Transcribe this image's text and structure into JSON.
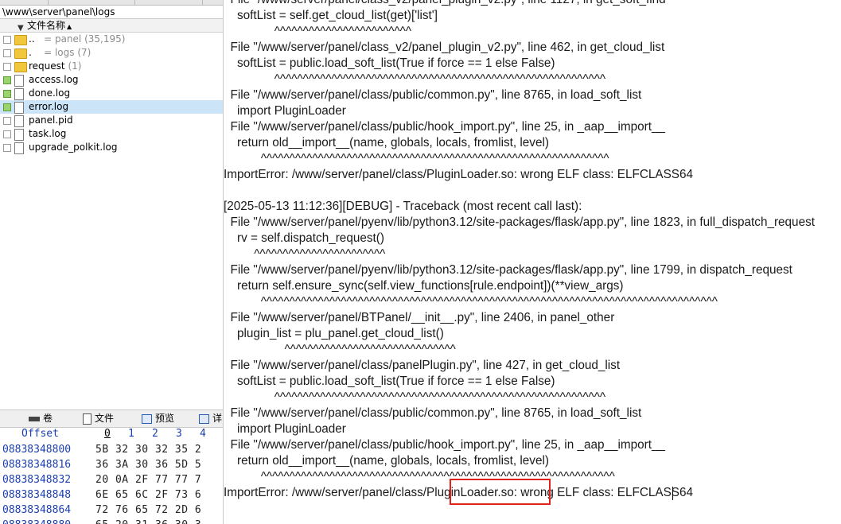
{
  "explorer": {
    "path": "\\www\\server\\panel\\logs",
    "column_header": "文件名称",
    "items": [
      {
        "name": "..",
        "suffix": "=   panel",
        "count": "(35,195)",
        "type": "folder"
      },
      {
        "name": ".",
        "suffix": "=   logs",
        "count": "(7)",
        "type": "folder"
      },
      {
        "name": "request",
        "count": "(1)",
        "type": "folder"
      },
      {
        "name": "access.log",
        "type": "file"
      },
      {
        "name": "done.log",
        "type": "file"
      },
      {
        "name": "error.log",
        "type": "file",
        "selected": true
      },
      {
        "name": "panel.pid",
        "type": "file"
      },
      {
        "name": "task.log",
        "type": "file"
      },
      {
        "name": "upgrade_polkit.log",
        "type": "file"
      }
    ]
  },
  "hex_tabs": [
    {
      "label": "卷",
      "icon": "volume-icon"
    },
    {
      "label": "文件",
      "icon": "file-icon"
    },
    {
      "label": "预览",
      "icon": "preview-icon"
    },
    {
      "label": "详",
      "icon": "details-icon"
    }
  ],
  "hex": {
    "offset_label": "Offset",
    "columns": [
      "0",
      "1",
      "2",
      "3",
      "4"
    ],
    "rows": [
      {
        "offset": "08838348800",
        "bytes": "5B 32 30 32 35 2"
      },
      {
        "offset": "08838348816",
        "bytes": "36 3A 30 36 5D 5"
      },
      {
        "offset": "08838348832",
        "bytes": "20 0A 2F 77 77 7"
      },
      {
        "offset": "08838348848",
        "bytes": "6E 65 6C 2F 73 6"
      },
      {
        "offset": "08838348864",
        "bytes": "72 76 65 72 2D 6"
      },
      {
        "offset": "08838348880",
        "bytes": "65 20 31 36 30 3"
      }
    ]
  },
  "log": {
    "lines": [
      "  File \"/www/server/panel/class_v2/panel_plugin_v2.py\", line 1127, in get_soft_find",
      "    softList = self.get_cloud_list(get)['list']",
      "               ^^^^^^^^^^^^^^^^^^^^^^^^",
      "  File \"/www/server/panel/class_v2/panel_plugin_v2.py\", line 462, in get_cloud_list",
      "    softList = public.load_soft_list(True if force == 1 else False)",
      "               ^^^^^^^^^^^^^^^^^^^^^^^^^^^^^^^^^^^^^^^^^^^^^^^^^^^^^^^^^^",
      "  File \"/www/server/panel/class/public/common.py\", line 8765, in load_soft_list",
      "    import PluginLoader",
      "  File \"/www/server/panel/class/public/hook_import.py\", line 25, in _aap__import__",
      "    return old__import__(name, globals, locals, fromlist, level)",
      "           ^^^^^^^^^^^^^^^^^^^^^^^^^^^^^^^^^^^^^^^^^^^^^^^^^^^^^^^^^^^^^",
      "ImportError: /www/server/panel/class/PluginLoader.so: wrong ELF class: ELFCLASS64",
      "",
      "[2025-05-13 11:12:36][DEBUG] - Traceback (most recent call last):",
      "  File \"/www/server/panel/pyenv/lib/python3.12/site-packages/flask/app.py\", line 1823, in full_dispatch_request",
      "    rv = self.dispatch_request()",
      "         ^^^^^^^^^^^^^^^^^^^^^^^",
      "  File \"/www/server/panel/pyenv/lib/python3.12/site-packages/flask/app.py\", line 1799, in dispatch_request",
      "    return self.ensure_sync(self.view_functions[rule.endpoint])(**view_args)",
      "           ^^^^^^^^^^^^^^^^^^^^^^^^^^^^^^^^^^^^^^^^^^^^^^^^^^^^^^^^^^^^^^^^^^^^^^^^^^^^^^^^",
      "  File \"/www/server/panel/BTPanel/__init__.py\", line 2406, in panel_other",
      "    plugin_list = plu_panel.get_cloud_list()",
      "                  ^^^^^^^^^^^^^^^^^^^^^^^^^^^^^^",
      "  File \"/www/server/panel/class/panelPlugin.py\", line 427, in get_cloud_list",
      "    softList = public.load_soft_list(True if force == 1 else False)",
      "               ^^^^^^^^^^^^^^^^^^^^^^^^^^^^^^^^^^^^^^^^^^^^^^^^^^^^^^^^^^",
      "  File \"/www/server/panel/class/public/common.py\", line 8765, in load_soft_list",
      "    import PluginLoader",
      "  File \"/www/server/panel/class/public/hook_import.py\", line 25, in _aap__import__",
      "    return old__import__(name, globals, locals, fromlist, level)",
      "           ^^^^^^^^^^^^^^^^^^^^^^^^^^^^^^^^^^^^^^^^^^^^^^^^^^^^^^^^^^^^^^",
      "ImportError: /www/server/panel/class/PluginLoader.so: wrong ELF class: ELFCLASS64"
    ]
  },
  "colors": {
    "highlight_box": "#e0221b",
    "selected_row": "#cce4f7",
    "hex_offset": "#1c3fb0"
  }
}
